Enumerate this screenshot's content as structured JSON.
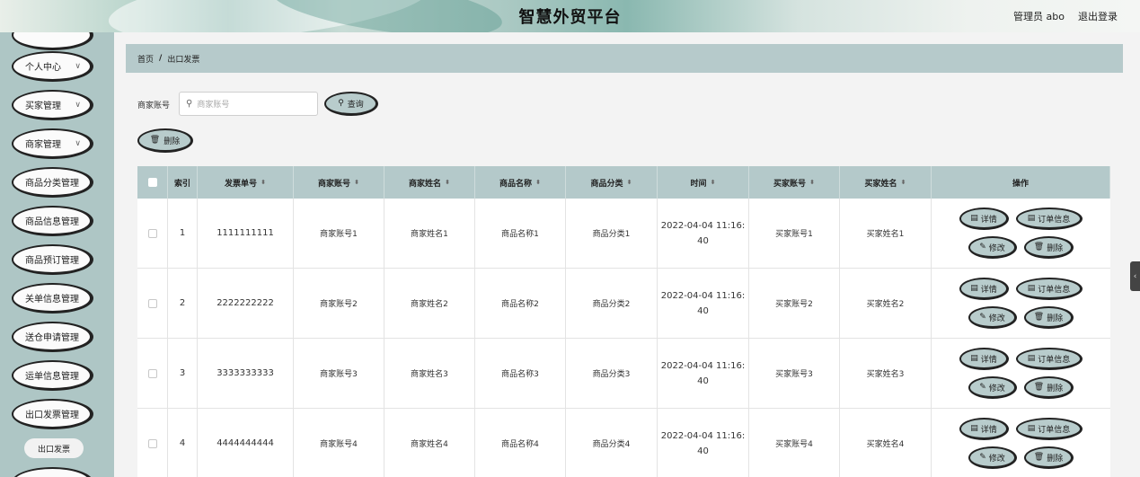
{
  "header": {
    "title": "智慧外贸平台",
    "user": "管理员 abo",
    "logout": "退出登录"
  },
  "sidebar": {
    "items": [
      {
        "label": "",
        "chevron": false
      },
      {
        "label": "个人中心",
        "chevron": true
      },
      {
        "label": "买家管理",
        "chevron": true
      },
      {
        "label": "商家管理",
        "chevron": true
      },
      {
        "label": "商品分类管理",
        "chevron": false
      },
      {
        "label": "商品信息管理",
        "chevron": false
      },
      {
        "label": "商品预订管理",
        "chevron": false
      },
      {
        "label": "关单信息管理",
        "chevron": false
      },
      {
        "label": "送仓申请管理",
        "chevron": false
      },
      {
        "label": "运单信息管理",
        "chevron": false
      },
      {
        "label": "出口发票管理",
        "chevron": false
      },
      {
        "label": "",
        "chevron": false
      }
    ],
    "sub_item": "出口发票"
  },
  "breadcrumb": {
    "home": "首页",
    "separator": "/",
    "current": "出口发票"
  },
  "search": {
    "label": "商家账号",
    "placeholder": "商家账号",
    "query_button": "查询",
    "delete_button": "删除"
  },
  "table": {
    "columns": [
      "",
      "索引",
      "发票单号",
      "商家账号",
      "商家姓名",
      "商品名称",
      "商品分类",
      "时间",
      "买家账号",
      "买家姓名",
      "操作"
    ],
    "sortable": [
      false,
      false,
      true,
      true,
      true,
      true,
      true,
      true,
      true,
      true,
      false
    ],
    "actions": {
      "detail": "详情",
      "order_info": "订单信息",
      "edit": "修改",
      "delete": "删除"
    },
    "rows": [
      {
        "index": "1",
        "invoice_no": "1111111111",
        "merchant_account": "商家账号1",
        "merchant_name": "商家姓名1",
        "product_name": "商品名称1",
        "product_category": "商品分类1",
        "time": "2022-04-04 11:16:40",
        "buyer_account": "买家账号1",
        "buyer_name": "买家姓名1"
      },
      {
        "index": "2",
        "invoice_no": "2222222222",
        "merchant_account": "商家账号2",
        "merchant_name": "商家姓名2",
        "product_name": "商品名称2",
        "product_category": "商品分类2",
        "time": "2022-04-04 11:16:40",
        "buyer_account": "买家账号2",
        "buyer_name": "买家姓名2"
      },
      {
        "index": "3",
        "invoice_no": "3333333333",
        "merchant_account": "商家账号3",
        "merchant_name": "商家姓名3",
        "product_name": "商品名称3",
        "product_category": "商品分类3",
        "time": "2022-04-04 11:16:40",
        "buyer_account": "买家账号3",
        "buyer_name": "买家姓名3"
      },
      {
        "index": "4",
        "invoice_no": "4444444444",
        "merchant_account": "商家账号4",
        "merchant_name": "商家姓名4",
        "product_name": "商品名称4",
        "product_category": "商品分类4",
        "time": "2022-04-04 11:16:40",
        "buyer_account": "买家账号4",
        "buyer_name": "买家姓名4"
      }
    ]
  },
  "colors": {
    "accent": "#b8cccc",
    "sidebar": "#aec6c5",
    "header_bar": "#b4c9ca"
  },
  "icons": {
    "search": "search-icon",
    "trash": "trash-icon",
    "document": "document-icon",
    "edit": "edit-icon",
    "chevron": "chevron-down-icon",
    "collapse": "chevron-left-icon"
  }
}
